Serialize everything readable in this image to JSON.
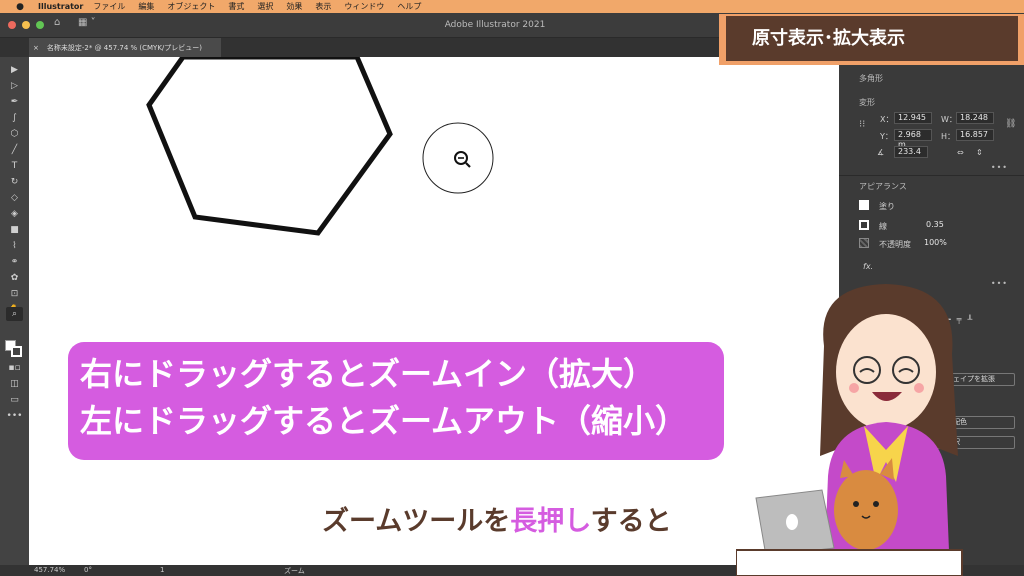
{
  "menubar": {
    "app_name": "Illustrator",
    "items": [
      "ファイル",
      "編集",
      "オブジェクト",
      "書式",
      "選択",
      "効果",
      "表示",
      "ウィンドウ",
      "ヘルプ"
    ]
  },
  "window": {
    "title": "Adobe Illustrator 2021",
    "tab_label": "名称未設定-2* @ 457.74 % (CMYK/プレビュー)",
    "tab_close": "×"
  },
  "badge": {
    "text": "原寸表示･拡大表示"
  },
  "properties": {
    "object_type": "多角形",
    "transform_title": "変形",
    "x_label": "X：",
    "x_value": "12.945",
    "y_label": "Y：",
    "y_value": "2.968 m",
    "w_label": "W：",
    "w_value": "18.248",
    "h_label": "H：",
    "h_value": "16.857",
    "angle_value": "233.4",
    "appearance_title": "アピアランス",
    "fill_label": "塗り",
    "stroke_label": "線",
    "stroke_value": "0.35",
    "opacity_label": "不透明度",
    "opacity_value": "100%",
    "fx_label": "fx.",
    "expand_shape_button": "シェイプを拡張",
    "recolor_button": "ェクトを再配色",
    "select_same_button": "トを一括選択",
    "more_dots": "•••"
  },
  "caption": {
    "line1": "右にドラッグするとズームイン（拡大）",
    "line2": "左にドラッグするとズームアウト（縮小）"
  },
  "subcaption": {
    "part1": "ズームツールを",
    "highlight": "長押し",
    "part2": "すると"
  },
  "statusbar": {
    "zoom": "457.74%",
    "rotation": "0°",
    "artboard": "1",
    "tool_name": "ズーム"
  },
  "colors": {
    "accent_orange": "#f0a068",
    "accent_brown": "#5a3b2c",
    "caption_magenta": "#d55ce0"
  },
  "icons": [
    "apple-icon",
    "home-icon",
    "workspace-icon",
    "zoom-out-cursor-icon",
    "constrain-link-icon"
  ]
}
